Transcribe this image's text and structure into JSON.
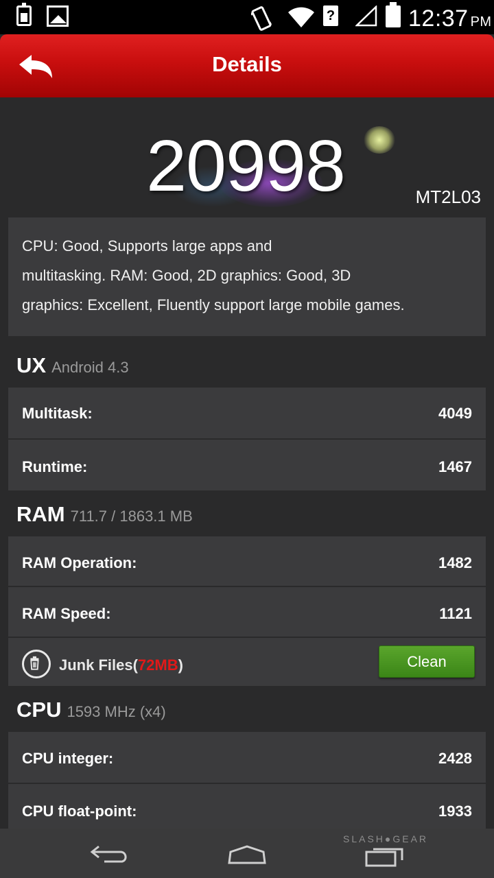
{
  "status_bar": {
    "time": "12:37",
    "ampm": "PM",
    "sim_label": "?"
  },
  "header": {
    "title": "Details"
  },
  "score": {
    "value": "20998",
    "model": "MT2L03"
  },
  "summary": {
    "line1": "CPU: Good, Supports large apps and",
    "line2": "multitasking. RAM: Good, 2D graphics: Good, 3D",
    "line3": "graphics: Excellent, Fluently support large mobile games."
  },
  "ux": {
    "title": "UX",
    "subtitle": "Android 4.3",
    "rows": [
      {
        "label": "Multitask:",
        "value": "4049"
      },
      {
        "label": "Runtime:",
        "value": "1467"
      }
    ]
  },
  "ram": {
    "title": "RAM",
    "subtitle": "711.7 / 1863.1 MB",
    "rows": [
      {
        "label": "RAM Operation:",
        "value": "1482"
      },
      {
        "label": "RAM Speed:",
        "value": "1121"
      }
    ],
    "junk": {
      "label": "Junk Files(",
      "size": "72MB",
      "close": ")",
      "button": "Clean"
    }
  },
  "cpu": {
    "title": "CPU",
    "subtitle": "1593 MHz (x4)",
    "rows": [
      {
        "label": "CPU integer:",
        "value": "2428"
      },
      {
        "label": "CPU float-point:",
        "value": "1933"
      }
    ]
  },
  "watermark": "SLASH●GEAR",
  "colors": {
    "header_red": "#c80e0e",
    "clean_green": "#4a9a22",
    "junk_red": "#e11919",
    "panel": "#3b3b3d",
    "background": "#2a2a2b"
  }
}
